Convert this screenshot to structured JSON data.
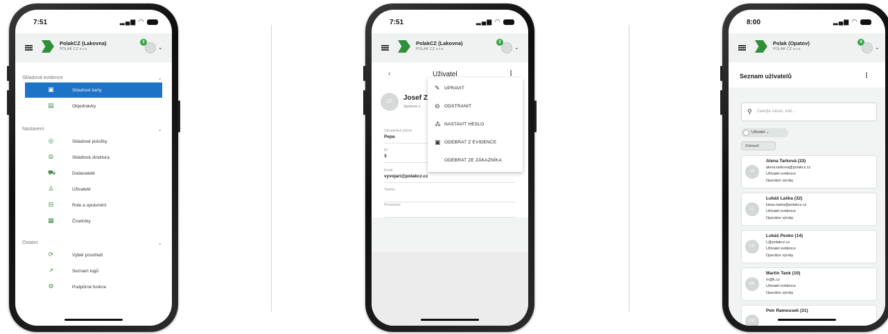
{
  "phone1": {
    "time": "7:51",
    "company": "PolakCZ (Lakovna)",
    "company_sub": "POLAK CZ s.r.o.",
    "badge": "2",
    "sections": [
      {
        "title": "Skladová evidence",
        "items": [
          {
            "label": "Skladové karty",
            "icon": "inventory-card-icon",
            "glyph": "▣",
            "active": true
          },
          {
            "label": "Objednávky",
            "icon": "orders-icon",
            "glyph": "▤",
            "active": false
          }
        ]
      },
      {
        "title": "Nastavení",
        "items": [
          {
            "label": "Skladové položky",
            "icon": "items-icon",
            "glyph": "◎",
            "active": false
          },
          {
            "label": "Skladová struktura",
            "icon": "structure-icon",
            "glyph": "⧉",
            "active": false
          },
          {
            "label": "Dodavatelé",
            "icon": "suppliers-icon",
            "glyph": "⛟",
            "active": false
          },
          {
            "label": "Uživatelé",
            "icon": "users-icon",
            "glyph": "♙",
            "active": false
          },
          {
            "label": "Role a oprávnění",
            "icon": "roles-icon",
            "glyph": "⊟",
            "active": false
          },
          {
            "label": "Číselníky",
            "icon": "codelists-icon",
            "glyph": "▦",
            "active": false
          }
        ]
      },
      {
        "title": "Ostatní",
        "items": [
          {
            "label": "Výběr prostředí",
            "icon": "environment-icon",
            "glyph": "⟳",
            "active": false
          },
          {
            "label": "Seznam logů",
            "icon": "logs-icon",
            "glyph": "↗",
            "active": false
          },
          {
            "label": "Podpůrné funkce",
            "icon": "support-icon",
            "glyph": "⚙",
            "active": false
          }
        ]
      }
    ]
  },
  "phone2": {
    "time": "7:51",
    "company": "PolakCZ (Lakovna)",
    "company_sub": "POLAK CZ s.r.o.",
    "badge": "2",
    "title": "Uživatel",
    "back": "‹",
    "kebab": "⋮",
    "profile": {
      "initials": "JZ",
      "name": "Josef Z",
      "role": "Správce z"
    },
    "fields": [
      {
        "label": "Uživatelské jméno",
        "value": "Pepa"
      },
      {
        "label": "ID",
        "value": "3"
      },
      {
        "label": "Email",
        "value": "vyvojari@polakcz.cz"
      },
      {
        "label": "Telefon",
        "value": ""
      },
      {
        "label": "Poznámka",
        "value": ""
      }
    ],
    "menu": [
      {
        "label": "UPRAVIT",
        "icon": "edit-icon",
        "glyph": "✎"
      },
      {
        "label": "ODSTRANIT",
        "icon": "delete-icon",
        "glyph": "⊖"
      },
      {
        "label": "NASTAVIT HESLO",
        "icon": "password-icon",
        "glyph": "⁂"
      },
      {
        "label": "ODEBRAT Z EVIDENCE",
        "icon": "remove-evidence-icon",
        "glyph": "▣"
      },
      {
        "label": "ODEBRAT ZE ZÁKAZNÍKA",
        "icon": "",
        "glyph": ""
      }
    ]
  },
  "phone3": {
    "time": "8:00",
    "company": "Polak (Opatov)",
    "company_sub": "POLAK CZ s.r.o.",
    "badge": "4",
    "title": "Seznam uživatelů",
    "kebab": "⋮",
    "search_placeholder": "Zadejte název, kód...",
    "filter_chip": "Uživatel ⌄",
    "clear_label": "Zobrazit",
    "users": [
      {
        "initials": "AT",
        "name": "Alena Tarková (33)",
        "email": "alena.tarkova@polakcz.cz",
        "group": "Uživatel evidence",
        "role": "Operátor výroby"
      },
      {
        "initials": "LL",
        "name": "Lukáš Laška (32)",
        "email": "lukas.laska@polakcz.cz",
        "group": "Uživatel evidence",
        "role": "Operátor výroby"
      },
      {
        "initials": "LP",
        "name": "Lukáš Pesko (14)",
        "email": "L@polakcz.cz",
        "group": "Uživatel evidence",
        "role": "Operátor výroby"
      },
      {
        "initials": "ML",
        "name": "Martin Tank (10)",
        "email": "m@k.cz",
        "group": "Uživatel evidence",
        "role": "Operátor výroby"
      },
      {
        "initials": "PR",
        "name": "Petr Ramousek (31)",
        "email": "",
        "group": "",
        "role": ""
      }
    ]
  },
  "colors": {
    "accent": "#1e73c6",
    "brand": "#2f8f3a",
    "badge": "#37a447"
  }
}
